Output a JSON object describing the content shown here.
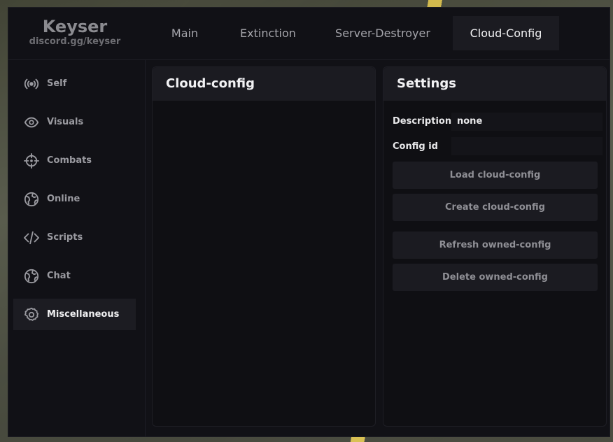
{
  "brand": {
    "name": "Keyser",
    "subtitle": "discord.gg/keyser"
  },
  "tabs": [
    {
      "label": "Main"
    },
    {
      "label": "Extinction"
    },
    {
      "label": "Server-Destroyer"
    },
    {
      "label": "Cloud-Config",
      "active": true
    }
  ],
  "sidebar": {
    "items": [
      {
        "label": "Self",
        "icon": "broadcast-icon"
      },
      {
        "label": "Visuals",
        "icon": "eye-icon"
      },
      {
        "label": "Combats",
        "icon": "crosshair-icon"
      },
      {
        "label": "Online",
        "icon": "globe-icon"
      },
      {
        "label": "Scripts",
        "icon": "code-icon"
      },
      {
        "label": "Chat",
        "icon": "globe-icon"
      },
      {
        "label": "Miscellaneous",
        "icon": "gear-icon",
        "active": true
      }
    ]
  },
  "cloud_panel": {
    "title": "Cloud-config"
  },
  "settings_panel": {
    "title": "Settings",
    "description_label": "Description",
    "description_value": "none",
    "config_id_label": "Config id",
    "config_id_value": "",
    "buttons": {
      "load": "Load cloud-config",
      "create": "Create cloud-config",
      "refresh": "Refresh owned-config",
      "delete": "Delete owned-config"
    }
  }
}
